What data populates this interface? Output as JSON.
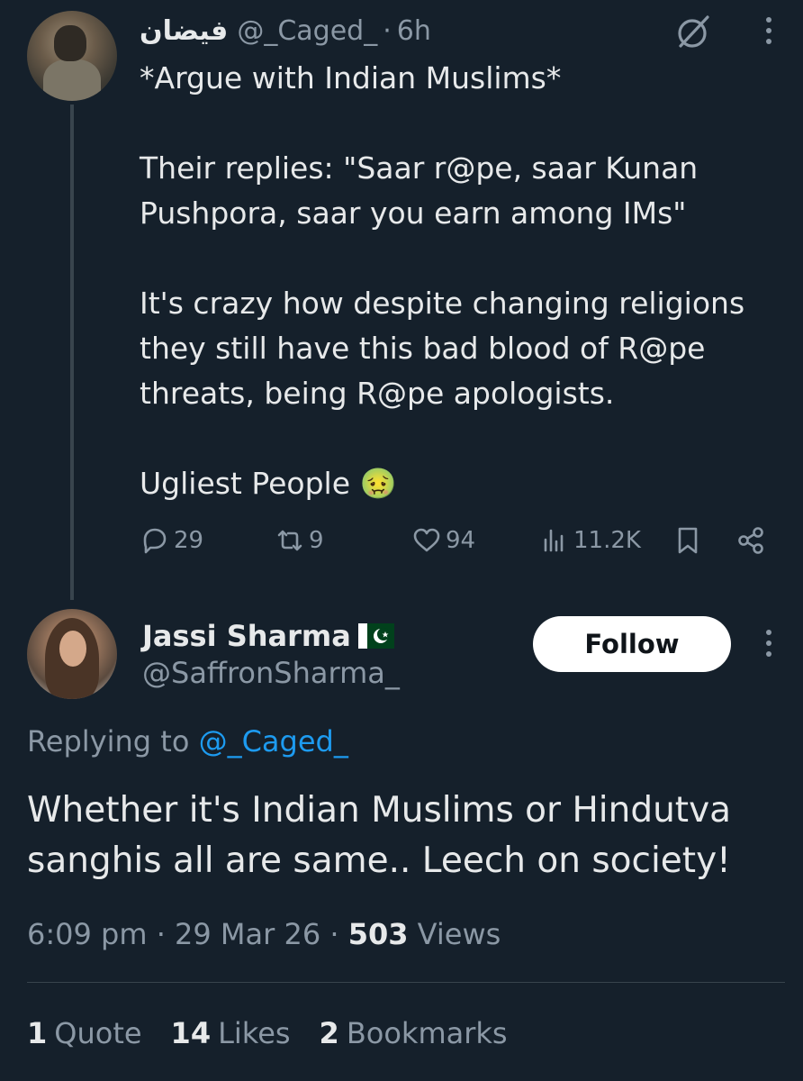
{
  "colors": {
    "background": "#15202b",
    "text_primary": "#e7e9ea",
    "text_secondary": "#8b98a5",
    "link": "#1d9bf0",
    "divider": "#38444d"
  },
  "parent_tweet": {
    "display_name": "فيضان",
    "handle": "@_Caged_",
    "separator": "·",
    "time": "6h",
    "paragraphs": [
      "*Argue with Indian Muslims*",
      "",
      "Their replies: \"Saar r@pe, saar Kunan Pushpora, saar you earn among IMs\"",
      "",
      "It's crazy how despite changing religions they still have this bad blood of R@pe threats, being R@pe apologists.",
      "",
      "Ugliest People 🤢"
    ],
    "actions": {
      "replies": "29",
      "reposts": "9",
      "likes": "94",
      "views": "11.2K"
    },
    "icons": [
      "grok-icon",
      "more-icon",
      "reply-icon",
      "repost-icon",
      "like-icon",
      "views-icon",
      "bookmark-icon",
      "share-icon"
    ]
  },
  "reply_tweet": {
    "display_name": "Jassi Sharma",
    "flag": "pakistan-flag",
    "handle": "@SaffronSharma_",
    "follow_label": "Follow",
    "replying_prefix": "Replying to",
    "replying_handle": "@_Caged_",
    "text": "Whether it's Indian Muslims or Hindutva sanghis all are same.. Leech on society!",
    "time": "6:09 pm",
    "date": "29 Mar 26",
    "separator": "·",
    "views_count": "503",
    "views_label": "Views",
    "stats": {
      "quotes_count": "1",
      "quotes_label": "Quote",
      "likes_count": "14",
      "likes_label": "Likes",
      "bookmarks_count": "2",
      "bookmarks_label": "Bookmarks"
    }
  }
}
